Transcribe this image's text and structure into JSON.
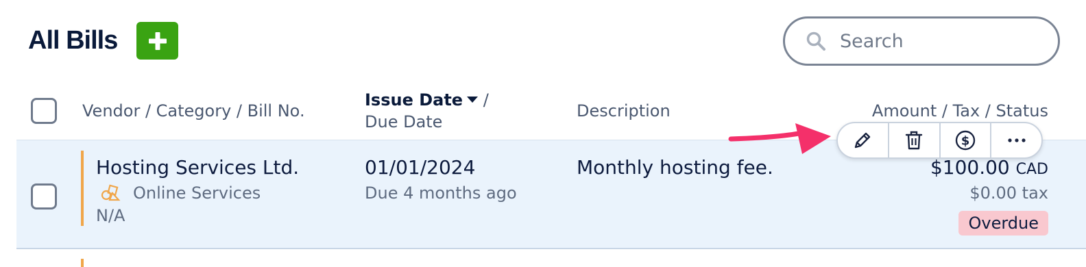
{
  "header": {
    "title": "All Bills",
    "add_icon": "plus-icon"
  },
  "search": {
    "placeholder": "Search",
    "icon": "search-icon"
  },
  "columns": {
    "vendor": "Vendor / Category / Bill No.",
    "issue_date": "Issue Date",
    "issue_sep": " /",
    "due_date": "Due Date",
    "description": "Description",
    "amount": "Amount / Tax / Status"
  },
  "rows": [
    {
      "vendor": "Hosting Services Ltd.",
      "category": "Online Services",
      "category_icon": "shapes-icon",
      "bill_no": "N/A",
      "issue_date": "01/01/2024",
      "due": "Due 4 months ago",
      "description": "Monthly hosting fee.",
      "amount": "$100.00",
      "currency": "CAD",
      "tax": "$0.00 tax",
      "status": "Overdue"
    }
  ],
  "toolbar": {
    "actions": [
      "pencil-icon",
      "trash-icon",
      "dollar-circle-icon",
      "more-icon"
    ]
  },
  "colors": {
    "add_button": "#3aa312",
    "row_highlight": "#eaf3fc",
    "accent_bar": "#f0a64a",
    "overdue_badge": "#f9c8cf",
    "annotation_arrow": "#f4306a"
  }
}
